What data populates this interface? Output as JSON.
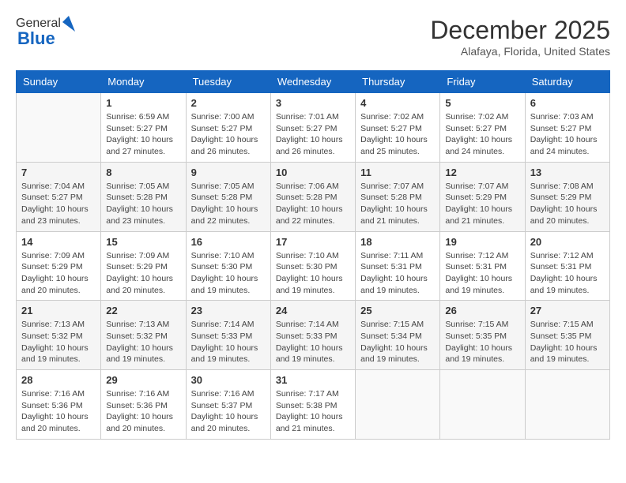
{
  "logo": {
    "general": "General",
    "blue": "Blue"
  },
  "header": {
    "month": "December 2025",
    "location": "Alafaya, Florida, United States"
  },
  "days_of_week": [
    "Sunday",
    "Monday",
    "Tuesday",
    "Wednesday",
    "Thursday",
    "Friday",
    "Saturday"
  ],
  "weeks": [
    [
      {
        "day": "",
        "empty": true
      },
      {
        "day": "1",
        "sunrise": "Sunrise: 6:59 AM",
        "sunset": "Sunset: 5:27 PM",
        "daylight": "Daylight: 10 hours and 27 minutes."
      },
      {
        "day": "2",
        "sunrise": "Sunrise: 7:00 AM",
        "sunset": "Sunset: 5:27 PM",
        "daylight": "Daylight: 10 hours and 26 minutes."
      },
      {
        "day": "3",
        "sunrise": "Sunrise: 7:01 AM",
        "sunset": "Sunset: 5:27 PM",
        "daylight": "Daylight: 10 hours and 26 minutes."
      },
      {
        "day": "4",
        "sunrise": "Sunrise: 7:02 AM",
        "sunset": "Sunset: 5:27 PM",
        "daylight": "Daylight: 10 hours and 25 minutes."
      },
      {
        "day": "5",
        "sunrise": "Sunrise: 7:02 AM",
        "sunset": "Sunset: 5:27 PM",
        "daylight": "Daylight: 10 hours and 24 minutes."
      },
      {
        "day": "6",
        "sunrise": "Sunrise: 7:03 AM",
        "sunset": "Sunset: 5:27 PM",
        "daylight": "Daylight: 10 hours and 24 minutes."
      }
    ],
    [
      {
        "day": "7",
        "sunrise": "Sunrise: 7:04 AM",
        "sunset": "Sunset: 5:27 PM",
        "daylight": "Daylight: 10 hours and 23 minutes."
      },
      {
        "day": "8",
        "sunrise": "Sunrise: 7:05 AM",
        "sunset": "Sunset: 5:28 PM",
        "daylight": "Daylight: 10 hours and 23 minutes."
      },
      {
        "day": "9",
        "sunrise": "Sunrise: 7:05 AM",
        "sunset": "Sunset: 5:28 PM",
        "daylight": "Daylight: 10 hours and 22 minutes."
      },
      {
        "day": "10",
        "sunrise": "Sunrise: 7:06 AM",
        "sunset": "Sunset: 5:28 PM",
        "daylight": "Daylight: 10 hours and 22 minutes."
      },
      {
        "day": "11",
        "sunrise": "Sunrise: 7:07 AM",
        "sunset": "Sunset: 5:28 PM",
        "daylight": "Daylight: 10 hours and 21 minutes."
      },
      {
        "day": "12",
        "sunrise": "Sunrise: 7:07 AM",
        "sunset": "Sunset: 5:29 PM",
        "daylight": "Daylight: 10 hours and 21 minutes."
      },
      {
        "day": "13",
        "sunrise": "Sunrise: 7:08 AM",
        "sunset": "Sunset: 5:29 PM",
        "daylight": "Daylight: 10 hours and 20 minutes."
      }
    ],
    [
      {
        "day": "14",
        "sunrise": "Sunrise: 7:09 AM",
        "sunset": "Sunset: 5:29 PM",
        "daylight": "Daylight: 10 hours and 20 minutes."
      },
      {
        "day": "15",
        "sunrise": "Sunrise: 7:09 AM",
        "sunset": "Sunset: 5:29 PM",
        "daylight": "Daylight: 10 hours and 20 minutes."
      },
      {
        "day": "16",
        "sunrise": "Sunrise: 7:10 AM",
        "sunset": "Sunset: 5:30 PM",
        "daylight": "Daylight: 10 hours and 19 minutes."
      },
      {
        "day": "17",
        "sunrise": "Sunrise: 7:10 AM",
        "sunset": "Sunset: 5:30 PM",
        "daylight": "Daylight: 10 hours and 19 minutes."
      },
      {
        "day": "18",
        "sunrise": "Sunrise: 7:11 AM",
        "sunset": "Sunset: 5:31 PM",
        "daylight": "Daylight: 10 hours and 19 minutes."
      },
      {
        "day": "19",
        "sunrise": "Sunrise: 7:12 AM",
        "sunset": "Sunset: 5:31 PM",
        "daylight": "Daylight: 10 hours and 19 minutes."
      },
      {
        "day": "20",
        "sunrise": "Sunrise: 7:12 AM",
        "sunset": "Sunset: 5:31 PM",
        "daylight": "Daylight: 10 hours and 19 minutes."
      }
    ],
    [
      {
        "day": "21",
        "sunrise": "Sunrise: 7:13 AM",
        "sunset": "Sunset: 5:32 PM",
        "daylight": "Daylight: 10 hours and 19 minutes."
      },
      {
        "day": "22",
        "sunrise": "Sunrise: 7:13 AM",
        "sunset": "Sunset: 5:32 PM",
        "daylight": "Daylight: 10 hours and 19 minutes."
      },
      {
        "day": "23",
        "sunrise": "Sunrise: 7:14 AM",
        "sunset": "Sunset: 5:33 PM",
        "daylight": "Daylight: 10 hours and 19 minutes."
      },
      {
        "day": "24",
        "sunrise": "Sunrise: 7:14 AM",
        "sunset": "Sunset: 5:33 PM",
        "daylight": "Daylight: 10 hours and 19 minutes."
      },
      {
        "day": "25",
        "sunrise": "Sunrise: 7:15 AM",
        "sunset": "Sunset: 5:34 PM",
        "daylight": "Daylight: 10 hours and 19 minutes."
      },
      {
        "day": "26",
        "sunrise": "Sunrise: 7:15 AM",
        "sunset": "Sunset: 5:35 PM",
        "daylight": "Daylight: 10 hours and 19 minutes."
      },
      {
        "day": "27",
        "sunrise": "Sunrise: 7:15 AM",
        "sunset": "Sunset: 5:35 PM",
        "daylight": "Daylight: 10 hours and 19 minutes."
      }
    ],
    [
      {
        "day": "28",
        "sunrise": "Sunrise: 7:16 AM",
        "sunset": "Sunset: 5:36 PM",
        "daylight": "Daylight: 10 hours and 20 minutes."
      },
      {
        "day": "29",
        "sunrise": "Sunrise: 7:16 AM",
        "sunset": "Sunset: 5:36 PM",
        "daylight": "Daylight: 10 hours and 20 minutes."
      },
      {
        "day": "30",
        "sunrise": "Sunrise: 7:16 AM",
        "sunset": "Sunset: 5:37 PM",
        "daylight": "Daylight: 10 hours and 20 minutes."
      },
      {
        "day": "31",
        "sunrise": "Sunrise: 7:17 AM",
        "sunset": "Sunset: 5:38 PM",
        "daylight": "Daylight: 10 hours and 21 minutes."
      },
      {
        "day": "",
        "empty": true
      },
      {
        "day": "",
        "empty": true
      },
      {
        "day": "",
        "empty": true
      }
    ]
  ]
}
